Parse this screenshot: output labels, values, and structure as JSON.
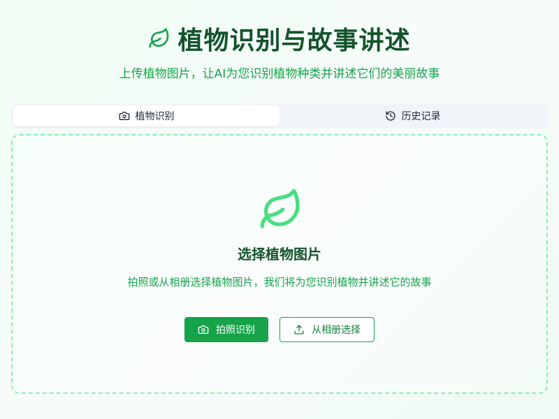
{
  "header": {
    "title": "植物识别与故事讲述",
    "subtitle": "上传植物图片，让AI为您识别植物种类并讲述它们的美丽故事",
    "logo_icon": "leaf-icon"
  },
  "tabs": [
    {
      "label": "植物识别",
      "icon": "camera-icon",
      "active": true
    },
    {
      "label": "历史记录",
      "icon": "history-icon",
      "active": false
    }
  ],
  "upload": {
    "icon": "leaf-icon",
    "title": "选择植物图片",
    "description": "拍照或从相册选择植物图片，我们将为您识别植物并讲述它的故事",
    "camera_button": {
      "label": "拍照识别",
      "icon": "camera-icon"
    },
    "album_button": {
      "label": "从相册选择",
      "icon": "upload-icon"
    }
  },
  "colors": {
    "primary": "#16a34a",
    "title": "#14532d",
    "dashed_border": "#86efac",
    "leaf_accent": "#4ade80"
  }
}
